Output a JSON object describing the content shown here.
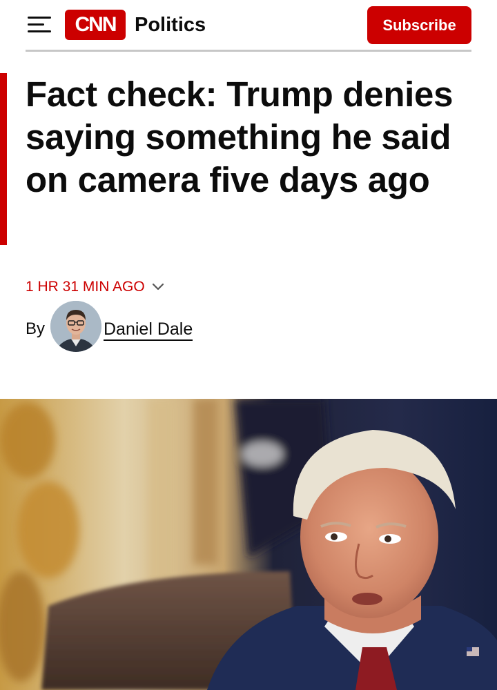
{
  "header": {
    "menu_icon": "hamburger-menu-icon",
    "logo_text": "CNN",
    "section": "Politics",
    "subscribe_label": "Subscribe"
  },
  "colors": {
    "brand_red": "#cc0000",
    "text": "#0c0c0c",
    "rule": "#c7c7c7"
  },
  "article": {
    "headline": "Fact check: Trump denies saying something he said on camera five days ago",
    "timestamp": "1 HR 31 MIN AGO",
    "timestamp_icon": "chevron-down-icon",
    "byline_prefix": "By",
    "author": "Daniel Dale"
  }
}
